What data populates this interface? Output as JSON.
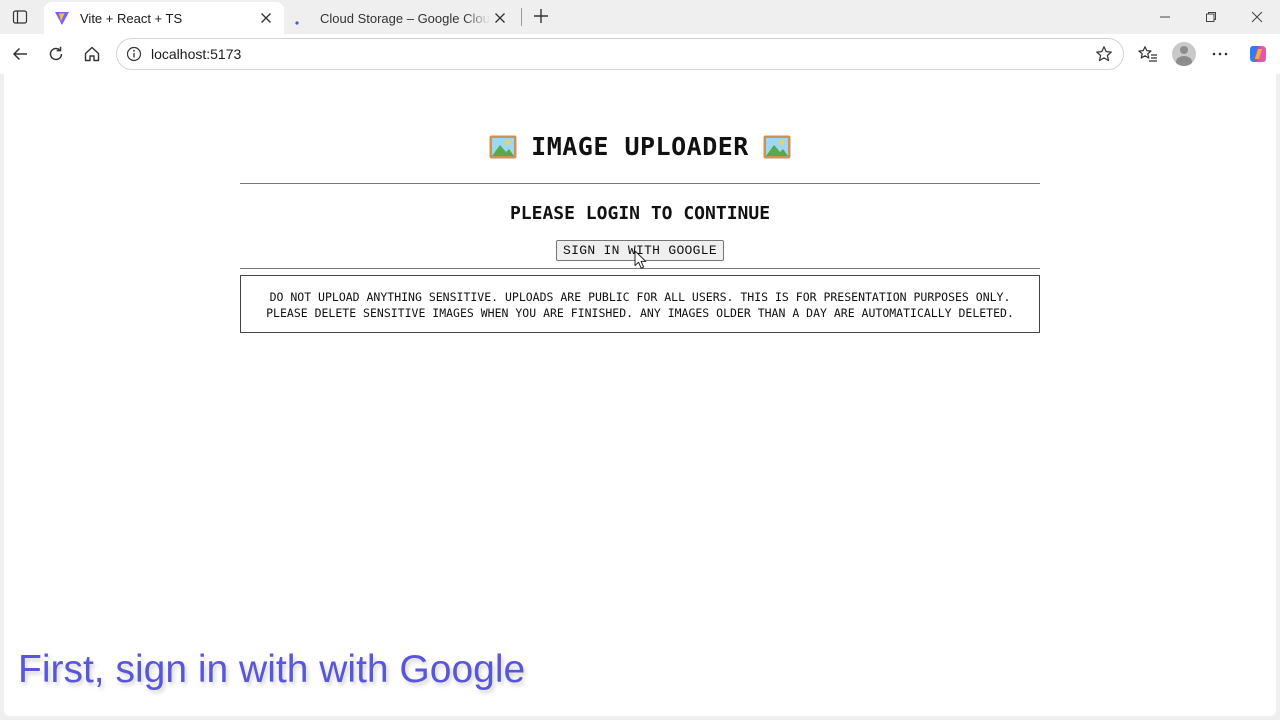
{
  "browser": {
    "tabs": [
      {
        "title": "Vite + React + TS",
        "favicon": "vite-icon",
        "active": true
      },
      {
        "title": "Cloud Storage – Google Cloud console",
        "favicon": "loading-dot-icon",
        "active": false
      }
    ],
    "address": {
      "url": "localhost:5173"
    }
  },
  "app": {
    "title": "IMAGE UPLOADER",
    "title_icon": "framed-picture-icon",
    "login_heading": "PLEASE LOGIN TO CONTINUE",
    "signin_label": "SIGN IN WITH GOOGLE",
    "notice": {
      "line1": "DO NOT UPLOAD ANYTHING SENSITIVE. UPLOADS ARE PUBLIC FOR ALL USERS. THIS IS FOR PRESENTATION PURPOSES ONLY.",
      "line2": "PLEASE DELETE SENSITIVE IMAGES WHEN YOU ARE FINISHED. ANY IMAGES OLDER THAN A DAY ARE AUTOMATICALLY DELETED."
    }
  },
  "caption": "First, sign in with with Google",
  "colors": {
    "caption": "#5a56d8",
    "vite_purple": "#7b61ff",
    "vite_yellow": "#ffc517",
    "loading_dot": "#3b5bdb"
  }
}
